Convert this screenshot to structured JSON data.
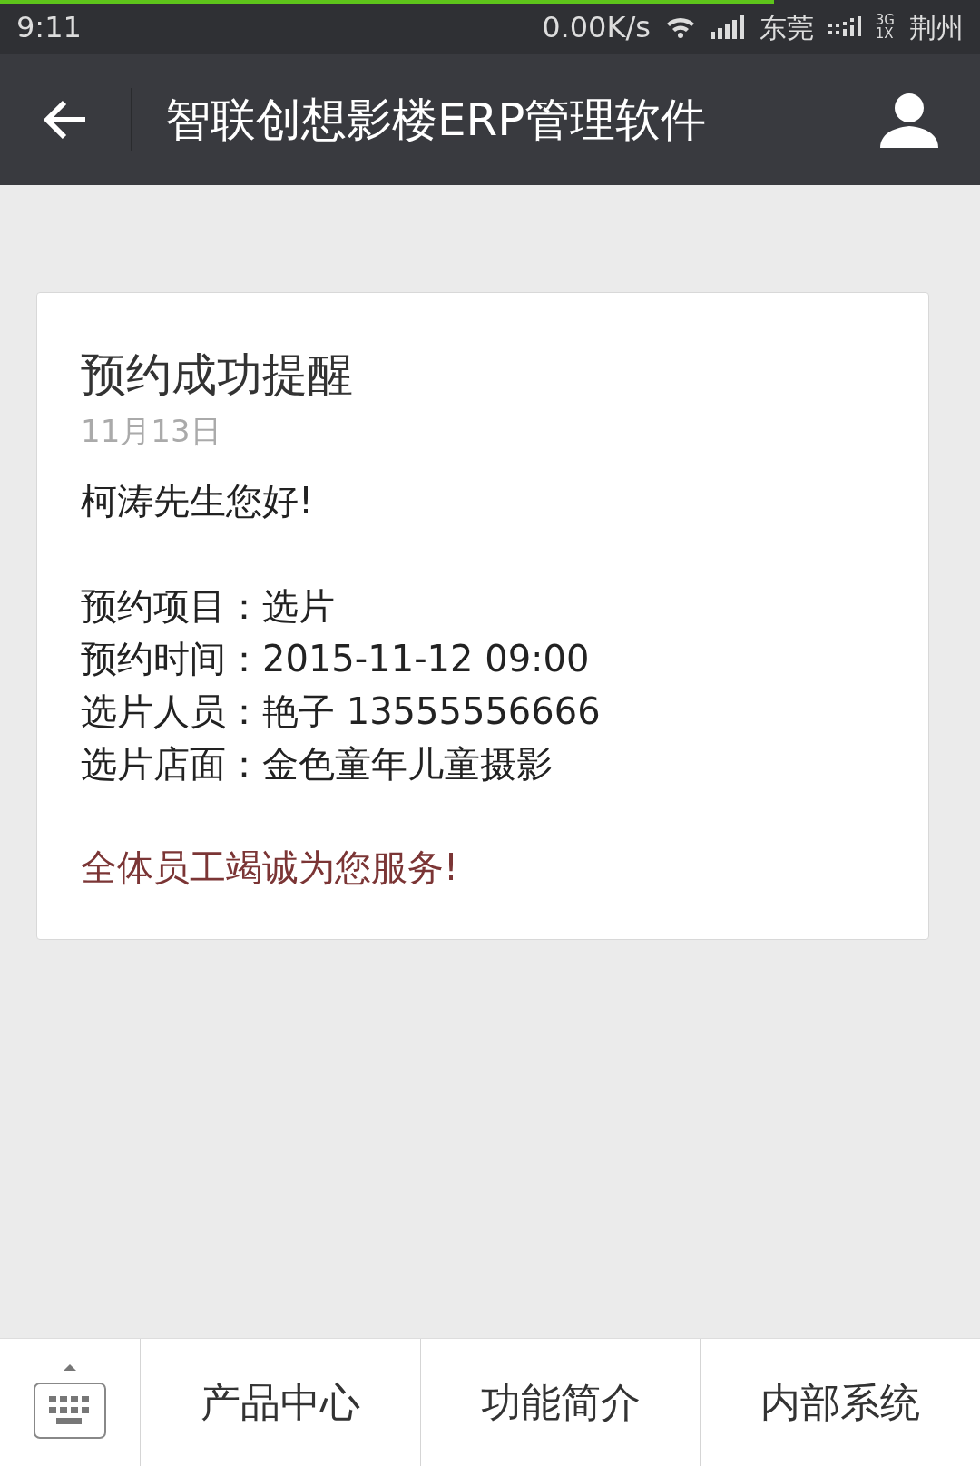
{
  "status_bar": {
    "time": "9:11",
    "speed": "0.00K/s",
    "carrier_1": "东莞",
    "network": "3G\n1X",
    "carrier_2": "荆州"
  },
  "loading": {
    "level": 0.79
  },
  "header": {
    "title": "智联创想影楼ERP管理软件"
  },
  "message": {
    "title": "预约成功提醒",
    "date": "11月13日",
    "greeting": "柯涛先生您好!",
    "details": [
      "预约项目：选片",
      "预约时间：2015-11-12 09:00",
      "选片人员：艳子 13555556666",
      "选片店面：金色童年儿童摄影"
    ],
    "closing": "全体员工竭诚为您服务!"
  },
  "menu": [
    {
      "label": "产品中心"
    },
    {
      "label": "功能简介"
    },
    {
      "label": "内部系统"
    }
  ]
}
